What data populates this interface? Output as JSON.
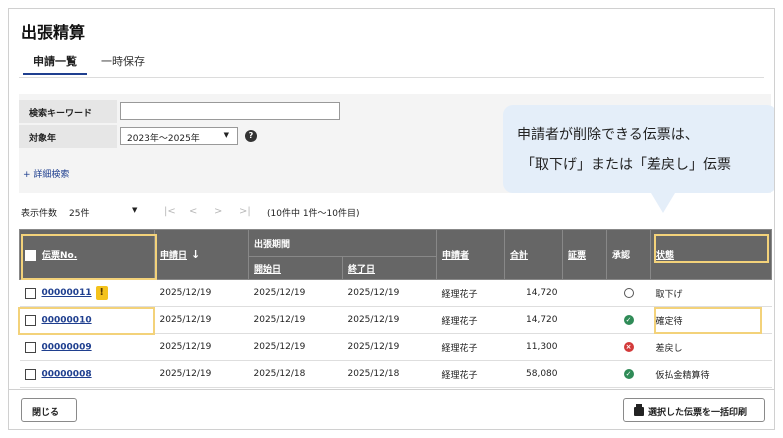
{
  "page": {
    "title": "出張精算"
  },
  "tabs": [
    {
      "label": "申請一覧",
      "active": true
    },
    {
      "label": "一時保存",
      "active": false
    }
  ],
  "search": {
    "keyword_label": "検索キーワード",
    "keyword_value": "",
    "year_label": "対象年",
    "year_value": "2023年～2025年",
    "help_icon": "?",
    "advanced_link": "+ 詳細検索"
  },
  "pager": {
    "count_label": "表示件数",
    "per_page": "25件",
    "nav": [
      "|<",
      "<",
      ">",
      ">|"
    ],
    "status": "(10件中 1件～10件目)"
  },
  "table": {
    "headers": {
      "slip_no": "伝票No.",
      "apply_date": "申請日",
      "sort_arrow": "↓",
      "period": "出張期間",
      "start": "開始日",
      "end": "終了日",
      "applicant": "申請者",
      "total": "合計",
      "evidence": "証票",
      "approval": "承認",
      "status": "状態"
    },
    "rows": [
      {
        "slip_no": "00000011",
        "warn": "!",
        "apply_date": "2025/12/19",
        "start": "2025/12/19",
        "end": "2025/12/19",
        "applicant": "経理花子",
        "total": "14,720",
        "approval_icon": "circle-outline",
        "status": "取下げ"
      },
      {
        "slip_no": "00000010",
        "warn": "",
        "apply_date": "2025/12/19",
        "start": "2025/12/19",
        "end": "2025/12/19",
        "applicant": "経理花子",
        "total": "14,720",
        "approval_icon": "check-green",
        "status": "確定待"
      },
      {
        "slip_no": "00000009",
        "warn": "",
        "apply_date": "2025/12/19",
        "start": "2025/12/19",
        "end": "2025/12/19",
        "applicant": "経理花子",
        "total": "11,300",
        "approval_icon": "x-red",
        "status": "差戻し"
      },
      {
        "slip_no": "00000008",
        "warn": "",
        "apply_date": "2025/12/19",
        "start": "2025/12/18",
        "end": "2025/12/18",
        "applicant": "経理花子",
        "total": "58,080",
        "approval_icon": "check-green",
        "status": "仮払金精算待"
      }
    ]
  },
  "callout": {
    "line1": "申請者が削除できる伝票は、",
    "line2": "「取下げ」または「差戻し」伝票"
  },
  "footer": {
    "close_label": "閉じる",
    "print_label": "選択した伝票を一括印刷"
  },
  "colors": {
    "header_bg": "#666666",
    "link": "#1f3f8f",
    "highlight": "#f3d27a",
    "callout_bg": "#e4eef9",
    "ok": "#2f8b57",
    "ng": "#d33a3a"
  }
}
